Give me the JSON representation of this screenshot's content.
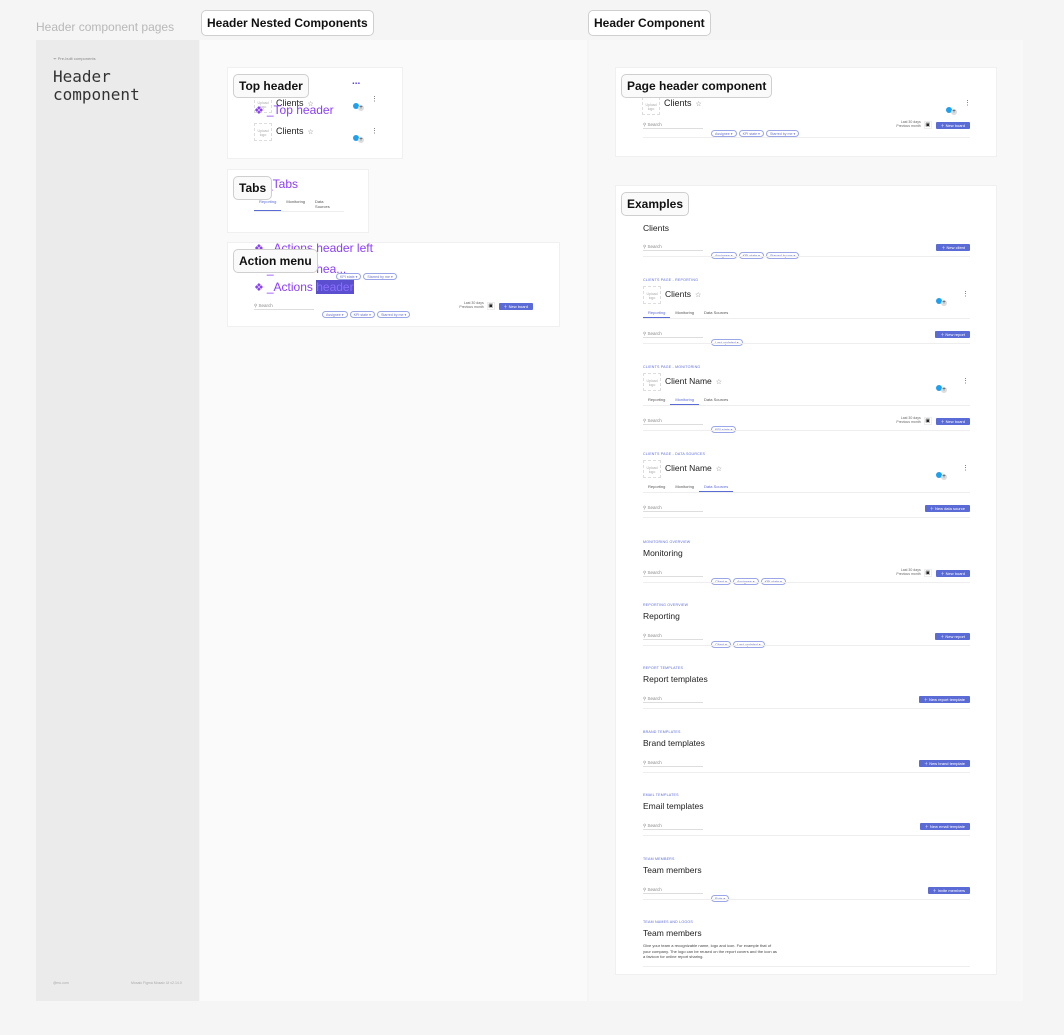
{
  "canvas": {
    "page_label": "Header component pages",
    "section_nested": "Header Nested Components",
    "section_component": "Header Component"
  },
  "cover": {
    "brand": "Pre-built components",
    "title_line1": "Header",
    "title_line2": "component",
    "footer_left": "@mc.com",
    "footer_right": "Mosaic Figma Mosaic UI v2.14.0"
  },
  "nested": {
    "top_header": {
      "tip": "Top header",
      "component": "_Top header",
      "title": "Clients",
      "logo": "Upload logo",
      "more": "..."
    },
    "tabs": {
      "tip": "Tabs",
      "component": "_Tabs",
      "items": [
        "Reporting",
        "Monitoring",
        "Data Sources"
      ],
      "active": 0
    },
    "action": {
      "tip": "Action menu",
      "comp_left": "_Actions header left",
      "comp_right": "_Actions hea...",
      "comp_main": "_Actions header",
      "highlight": "header",
      "chips_top": [
        "KPI state",
        "Starred by me"
      ],
      "search": "Search",
      "chips": [
        "Assignee",
        "KPI state",
        "Starred by me"
      ],
      "date_line1": "Last 30 days",
      "date_line2": "Previous month",
      "button": "New board"
    }
  },
  "page_header": {
    "tip": "Page header component",
    "logo": "Upload logo",
    "title": "Clients",
    "search": "Search",
    "chips": [
      "Assignee",
      "KPI state",
      "Starred by me"
    ],
    "date_line1": "Last 30 days",
    "date_line2": "Previous month",
    "button": "New board"
  },
  "examples": {
    "tip": "Examples",
    "tab_labels": [
      "Reporting",
      "Monitoring",
      "Data Sources"
    ],
    "search": "Search",
    "logo": "Upload logo",
    "date_line1": "Last 30 days",
    "date_line2": "Previous month",
    "items": [
      {
        "eyebrow": "",
        "title": "Clients",
        "chips": [
          "Assignee",
          "KPI state",
          "Starred by me"
        ],
        "button": "New client"
      },
      {
        "eyebrow": "CLIENTS PAGE - REPORTING",
        "title": "Clients",
        "logo": true,
        "tab": 0,
        "chips": [
          "Last updated"
        ],
        "button": "New report"
      },
      {
        "eyebrow": "CLIENTS PAGE - MONITORING",
        "title": "Client Name",
        "logo": true,
        "tab": 1,
        "chips": [
          "KPI state"
        ],
        "date": true,
        "button": "New board"
      },
      {
        "eyebrow": "CLIENTS PAGE - DATA SOURCES",
        "title": "Client Name",
        "logo": true,
        "tab": 2,
        "chips": [],
        "button": "New data source"
      },
      {
        "eyebrow": "MONITORING OVERVIEW",
        "title": "Monitoring",
        "chips": [
          "Client",
          "Assignee",
          "KPI state"
        ],
        "date": true,
        "button": "New board"
      },
      {
        "eyebrow": "REPORTING OVERVIEW",
        "title": "Reporting",
        "chips": [
          "Client",
          "Last updated"
        ],
        "button": "New report"
      },
      {
        "eyebrow": "REPORT TEMPLATES",
        "title": "Report templates",
        "chips": [],
        "button": "New report template"
      },
      {
        "eyebrow": "BRAND TEMPLATES",
        "title": "Brand templates",
        "chips": [],
        "button": "New brand template"
      },
      {
        "eyebrow": "EMAIL TEMPLATES",
        "title": "Email templates",
        "chips": [],
        "button": "New email template"
      },
      {
        "eyebrow": "TEAM MEMBERS",
        "title": "Team members",
        "chips": [
          "Role"
        ],
        "button": "Invite members"
      },
      {
        "eyebrow": "TEAM NAMES AND LOGOS",
        "title": "Team members",
        "paragraph": "Give your team a recognizable name, logo and icon. For example that of your company. The logo can be reused on the report covers and the icon as a favicon for online report sharing."
      }
    ]
  }
}
